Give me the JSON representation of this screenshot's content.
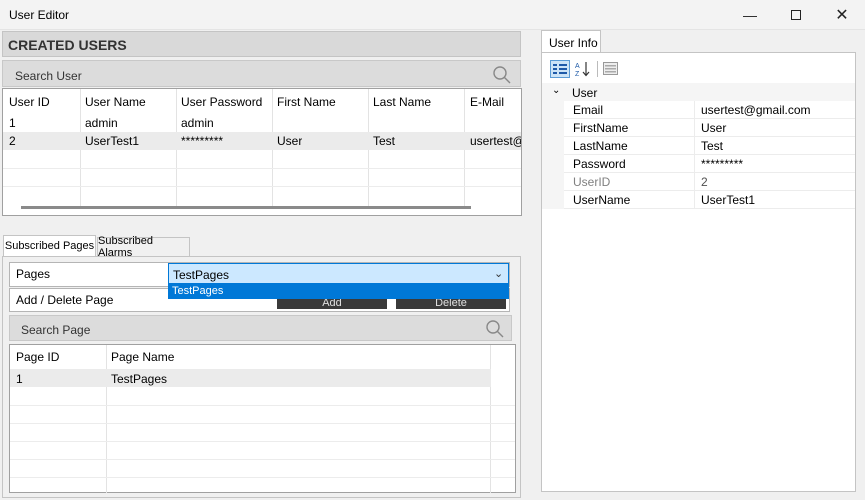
{
  "window": {
    "title": "User Editor",
    "minimize_icon": "minimize-icon",
    "maximize_icon": "maximize-icon",
    "close_icon": "close-icon"
  },
  "created_users": {
    "header": "CREATED USERS",
    "search_placeholder": "Search User",
    "columns": [
      "User ID",
      "User Name",
      "User Password",
      "First Name",
      "Last Name",
      "E-Mail"
    ],
    "rows": [
      [
        "1",
        "admin",
        "admin",
        "",
        "",
        ""
      ],
      [
        "2",
        "UserTest1",
        "*********",
        "User",
        "Test",
        "usertest@"
      ]
    ]
  },
  "tabs": [
    {
      "label": "Subscribed Pages",
      "active": true
    },
    {
      "label": "Subscribed Alarms",
      "active": false
    }
  ],
  "pages_section": {
    "pages_label": "Pages",
    "pages_selected": "TestPages",
    "pages_options": [
      "TestPages"
    ],
    "add_delete_label": "Add / Delete Page",
    "add_button": "Add",
    "delete_button": "Delete",
    "search_placeholder": "Search Page",
    "columns": [
      "Page ID",
      "Page Name"
    ],
    "rows": [
      [
        "1",
        "TestPages"
      ]
    ]
  },
  "user_info": {
    "tab_label": "User Info",
    "category": "User",
    "properties": [
      {
        "name": "Email",
        "value": "usertest@gmail.com",
        "readonly": false
      },
      {
        "name": "FirstName",
        "value": "User",
        "readonly": false
      },
      {
        "name": "LastName",
        "value": "Test",
        "readonly": false
      },
      {
        "name": "Password",
        "value": "*********",
        "readonly": false
      },
      {
        "name": "UserID",
        "value": "2",
        "readonly": true
      },
      {
        "name": "UserName",
        "value": "UserTest1",
        "readonly": false
      }
    ]
  },
  "colors": {
    "selection": "#0078d7",
    "dropdown_bg": "#cce8ff",
    "dark_button": "#3a3a3a"
  }
}
